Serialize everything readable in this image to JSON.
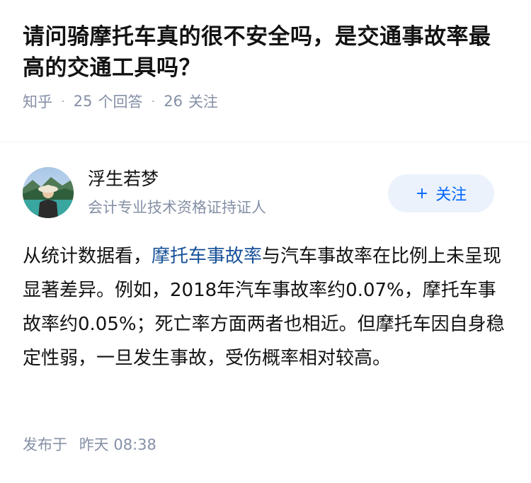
{
  "question": {
    "title": "请问骑摩托车真的很不安全吗，是交通事故率最高的交通工具吗？",
    "source": "知乎",
    "answer_count": "25",
    "answer_label": "个回答",
    "follow_count": "26",
    "follow_label": "关注"
  },
  "answer": {
    "author": {
      "name": "浮生若梦",
      "headline": "会计专业技术资格证持证人",
      "follow_button_label": "关注",
      "follow_button_icon": "plus-icon"
    },
    "content": {
      "before_link": "从统计数据看，",
      "link_text": "摩托车事故率",
      "after_link": "与汽车事故率在比例上未呈现显著差异。例如，2018年汽车事故率约0.07%，摩托车事故率约0.05%；死亡率方面两者也相近。但摩托车因自身稳定性弱，一旦发生事故，受伤概率相对较高。"
    },
    "published_label": "发布于",
    "published_time": "昨天 08:38"
  },
  "colors": {
    "link": "#175199",
    "meta_gray": "#8590a6",
    "follow_bg": "#ebf2fb",
    "follow_text": "#0066ff"
  }
}
